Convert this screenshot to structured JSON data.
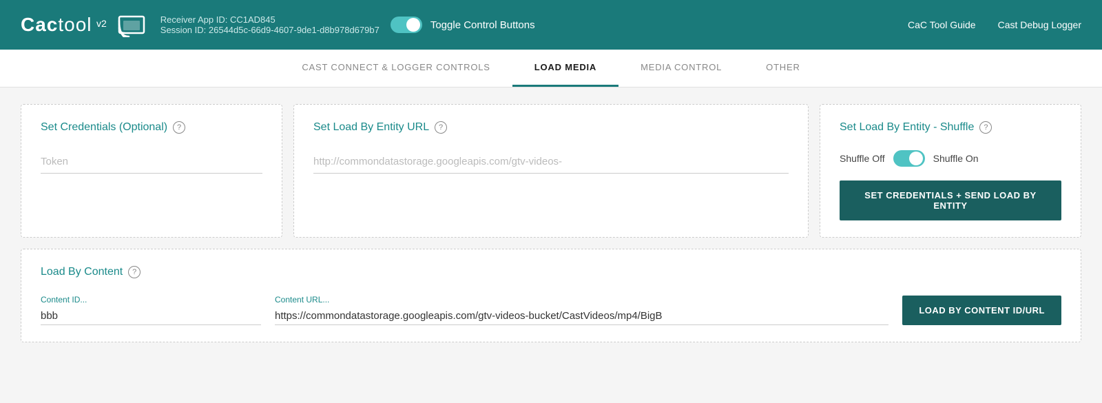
{
  "header": {
    "logo": "Cactool",
    "version": "v2",
    "receiver_app_label": "Receiver App ID:",
    "receiver_app_id": "CC1AD845",
    "session_label": "Session ID:",
    "session_id": "26544d5c-66d9-4607-9de1-d8b978d679b7",
    "toggle_label": "Toggle Control Buttons",
    "nav": {
      "guide": "CaC Tool Guide",
      "logger": "Cast Debug Logger"
    }
  },
  "tabs": [
    {
      "id": "cast-connect",
      "label": "CAST CONNECT & LOGGER CONTROLS",
      "active": false
    },
    {
      "id": "load-media",
      "label": "LOAD MEDIA",
      "active": true
    },
    {
      "id": "media-control",
      "label": "MEDIA CONTROL",
      "active": false
    },
    {
      "id": "other",
      "label": "OTHER",
      "active": false
    }
  ],
  "cards": {
    "credentials": {
      "title": "Set Credentials (Optional)",
      "token_placeholder": "Token"
    },
    "entity_url": {
      "title": "Set Load By Entity URL",
      "url_placeholder": "http://commondatastorage.googleapis.com/gtv-videos-"
    },
    "shuffle": {
      "title": "Set Load By Entity - Shuffle",
      "shuffle_off": "Shuffle Off",
      "shuffle_on": "Shuffle On",
      "button": "SET CREDENTIALS + SEND LOAD BY ENTITY"
    },
    "load_by_content": {
      "title": "Load By Content",
      "content_id_label": "Content ID...",
      "content_id_value": "bbb",
      "content_url_label": "Content URL...",
      "content_url_value": "https://commondatastorage.googleapis.com/gtv-videos-bucket/CastVideos/mp4/BigB",
      "button": "LOAD BY CONTENT ID/URL"
    }
  }
}
